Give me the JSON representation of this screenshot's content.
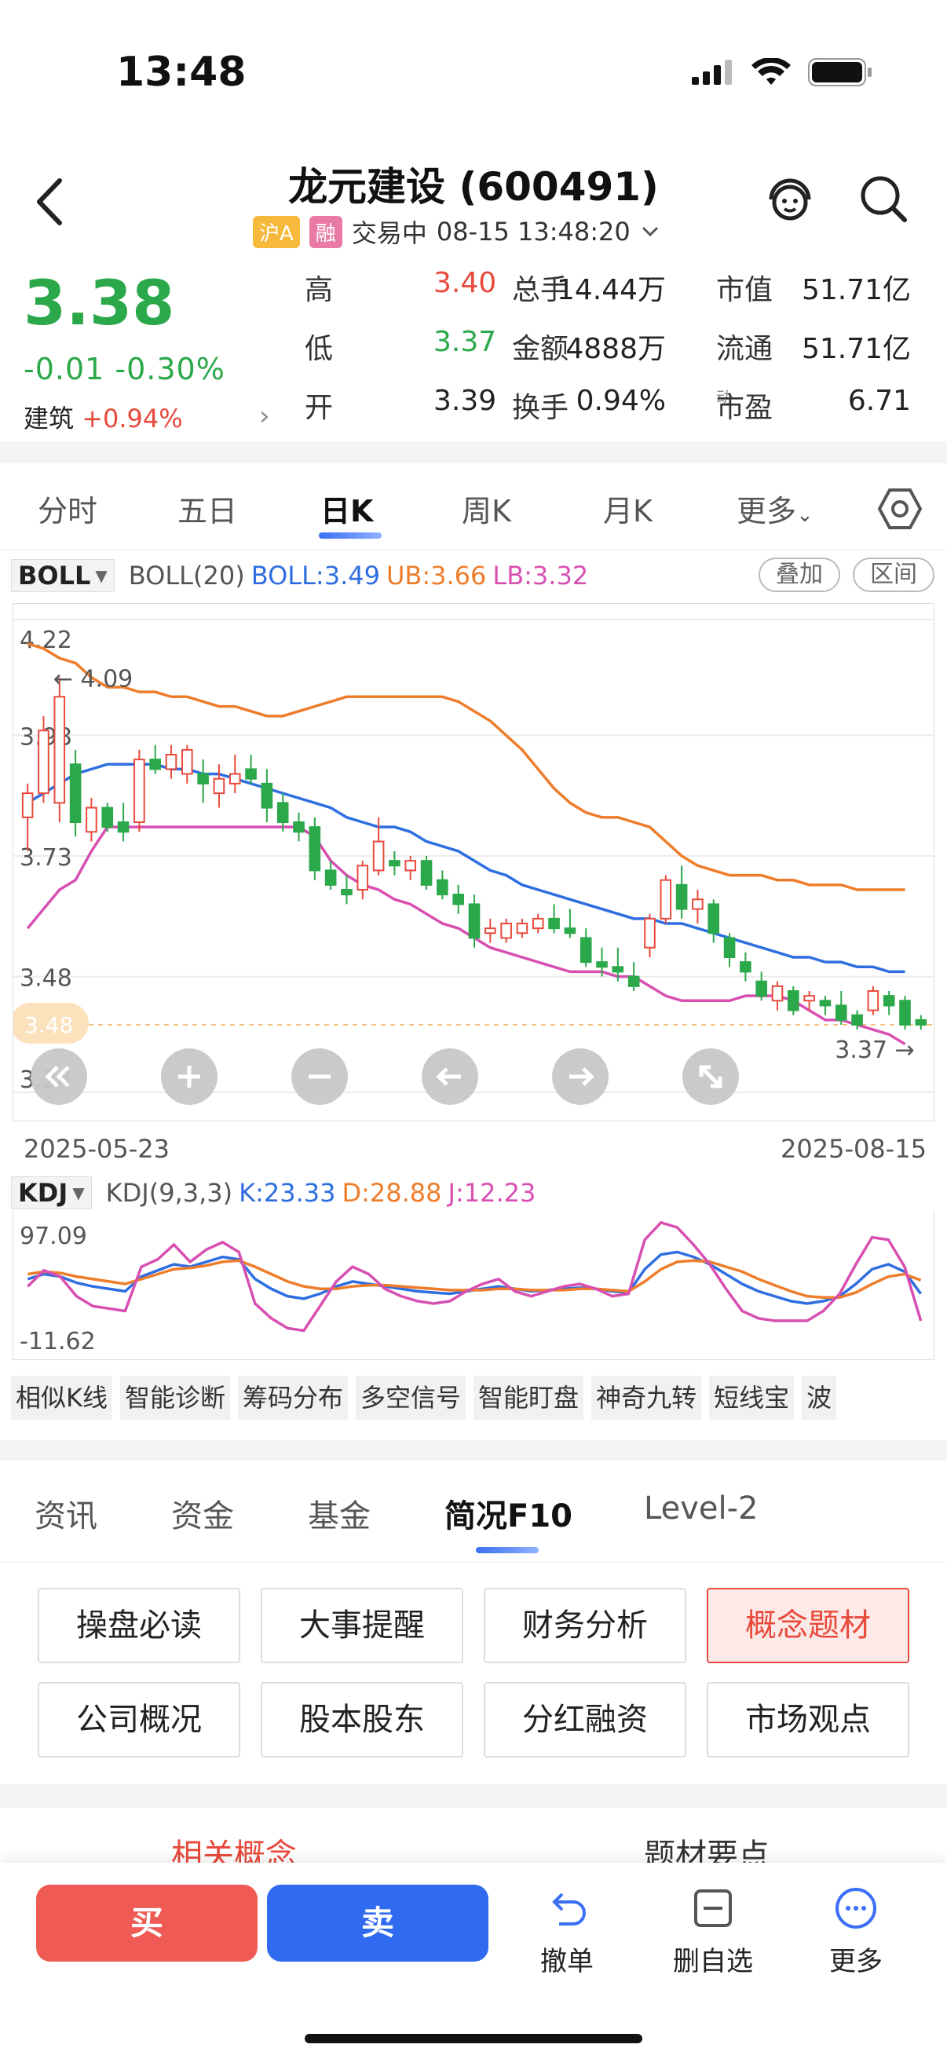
{
  "status": {
    "time": "13:48"
  },
  "header": {
    "title": "龙元建设 (600491)",
    "market_tag": "沪A",
    "margin_tag": "融",
    "trade_status": "交易中",
    "datetime": "08-15 13:48:20"
  },
  "quote": {
    "price": "3.38",
    "change": "-0.01 -0.30%",
    "sector_name": "建筑",
    "sector_change": "+0.94%",
    "rows": [
      {
        "l1": "高",
        "v1": "3.40",
        "l2": "总手",
        "v2": "14.44万",
        "l3": "市值",
        "v3": "51.71亿"
      },
      {
        "l1": "低",
        "v1": "3.37",
        "l2": "金额",
        "v2": "4888万",
        "l3": "流通",
        "v3": "51.71亿"
      },
      {
        "l1": "开",
        "v1": "3.39",
        "l2": "换手",
        "v2": "0.94%",
        "l3": "市盈",
        "l3_sup": "动",
        "v3": "6.71"
      }
    ]
  },
  "chart_tabs": [
    "分时",
    "五日",
    "日K",
    "周K",
    "月K",
    "更多"
  ],
  "boll_legend": {
    "indicator": "BOLL",
    "params": "BOLL(20)",
    "boll": "BOLL:3.49",
    "ub": "UB:3.66",
    "lb": "LB:3.32",
    "overlay_btn": "叠加",
    "range_btn": "区间"
  },
  "kdj_legend": {
    "indicator": "KDJ",
    "params": "KDJ(9,3,3)",
    "k": "K:23.33",
    "d": "D:28.88",
    "j": "J:12.23"
  },
  "colors": {
    "up": "#e84a3c",
    "down": "#2aa84a",
    "boll": "#2f6ee0",
    "ub": "#ee7d2b",
    "lb": "#d84fb2"
  },
  "chart_data": [
    {
      "type": "candlestick",
      "title": "",
      "y_tick_labels": [
        "4.22",
        "3.98",
        "3.73",
        "3.48",
        "3.24"
      ],
      "ylim": [
        3.24,
        4.22
      ],
      "x_tick_labels": [
        "2025-05-23",
        "2025-08-15"
      ],
      "annotations": {
        "high_label": "4.09",
        "low_label": "3.37",
        "current_price_badge": "3.48"
      },
      "candles": [
        {
          "o": 3.81,
          "h": 3.88,
          "l": 3.74,
          "c": 3.86
        },
        {
          "o": 3.86,
          "h": 4.02,
          "l": 3.84,
          "c": 3.99
        },
        {
          "o": 3.84,
          "h": 4.1,
          "l": 3.8,
          "c": 4.06
        },
        {
          "o": 3.92,
          "h": 3.95,
          "l": 3.77,
          "c": 3.8
        },
        {
          "o": 3.78,
          "h": 3.85,
          "l": 3.76,
          "c": 3.83
        },
        {
          "o": 3.83,
          "h": 3.84,
          "l": 3.78,
          "c": 3.79
        },
        {
          "o": 3.8,
          "h": 3.84,
          "l": 3.76,
          "c": 3.78
        },
        {
          "o": 3.8,
          "h": 3.95,
          "l": 3.78,
          "c": 3.93
        },
        {
          "o": 3.93,
          "h": 3.96,
          "l": 3.9,
          "c": 3.91
        },
        {
          "o": 3.91,
          "h": 3.96,
          "l": 3.89,
          "c": 3.94
        },
        {
          "o": 3.9,
          "h": 3.96,
          "l": 3.88,
          "c": 3.95
        },
        {
          "o": 3.9,
          "h": 3.93,
          "l": 3.84,
          "c": 3.88
        },
        {
          "o": 3.86,
          "h": 3.92,
          "l": 3.83,
          "c": 3.89
        },
        {
          "o": 3.88,
          "h": 3.94,
          "l": 3.86,
          "c": 3.9
        },
        {
          "o": 3.91,
          "h": 3.94,
          "l": 3.88,
          "c": 3.89
        },
        {
          "o": 3.88,
          "h": 3.91,
          "l": 3.8,
          "c": 3.83
        },
        {
          "o": 3.84,
          "h": 3.86,
          "l": 3.78,
          "c": 3.8
        },
        {
          "o": 3.8,
          "h": 3.82,
          "l": 3.76,
          "c": 3.78
        },
        {
          "o": 3.79,
          "h": 3.81,
          "l": 3.68,
          "c": 3.7
        },
        {
          "o": 3.7,
          "h": 3.72,
          "l": 3.66,
          "c": 3.67
        },
        {
          "o": 3.66,
          "h": 3.69,
          "l": 3.63,
          "c": 3.65
        },
        {
          "o": 3.66,
          "h": 3.72,
          "l": 3.64,
          "c": 3.71
        },
        {
          "o": 3.7,
          "h": 3.81,
          "l": 3.69,
          "c": 3.76
        },
        {
          "o": 3.72,
          "h": 3.74,
          "l": 3.69,
          "c": 3.71
        },
        {
          "o": 3.7,
          "h": 3.73,
          "l": 3.68,
          "c": 3.72
        },
        {
          "o": 3.72,
          "h": 3.73,
          "l": 3.66,
          "c": 3.67
        },
        {
          "o": 3.68,
          "h": 3.7,
          "l": 3.64,
          "c": 3.65
        },
        {
          "o": 3.65,
          "h": 3.67,
          "l": 3.61,
          "c": 3.63
        },
        {
          "o": 3.63,
          "h": 3.65,
          "l": 3.54,
          "c": 3.56
        },
        {
          "o": 3.57,
          "h": 3.6,
          "l": 3.55,
          "c": 3.58
        },
        {
          "o": 3.56,
          "h": 3.6,
          "l": 3.55,
          "c": 3.59
        },
        {
          "o": 3.57,
          "h": 3.6,
          "l": 3.56,
          "c": 3.59
        },
        {
          "o": 3.58,
          "h": 3.61,
          "l": 3.57,
          "c": 3.6
        },
        {
          "o": 3.6,
          "h": 3.63,
          "l": 3.57,
          "c": 3.58
        },
        {
          "o": 3.58,
          "h": 3.62,
          "l": 3.56,
          "c": 3.57
        },
        {
          "o": 3.56,
          "h": 3.58,
          "l": 3.5,
          "c": 3.51
        },
        {
          "o": 3.51,
          "h": 3.54,
          "l": 3.48,
          "c": 3.5
        },
        {
          "o": 3.5,
          "h": 3.54,
          "l": 3.47,
          "c": 3.49
        },
        {
          "o": 3.48,
          "h": 3.51,
          "l": 3.45,
          "c": 3.46
        },
        {
          "o": 3.54,
          "h": 3.61,
          "l": 3.52,
          "c": 3.6
        },
        {
          "o": 3.6,
          "h": 3.69,
          "l": 3.59,
          "c": 3.68
        },
        {
          "o": 3.67,
          "h": 3.71,
          "l": 3.6,
          "c": 3.62
        },
        {
          "o": 3.62,
          "h": 3.66,
          "l": 3.59,
          "c": 3.64
        },
        {
          "o": 3.63,
          "h": 3.64,
          "l": 3.55,
          "c": 3.57
        },
        {
          "o": 3.56,
          "h": 3.57,
          "l": 3.5,
          "c": 3.52
        },
        {
          "o": 3.51,
          "h": 3.53,
          "l": 3.47,
          "c": 3.49
        },
        {
          "o": 3.47,
          "h": 3.49,
          "l": 3.43,
          "c": 3.44
        },
        {
          "o": 3.43,
          "h": 3.47,
          "l": 3.41,
          "c": 3.46
        },
        {
          "o": 3.45,
          "h": 3.46,
          "l": 3.4,
          "c": 3.41
        },
        {
          "o": 3.43,
          "h": 3.45,
          "l": 3.41,
          "c": 3.44
        },
        {
          "o": 3.43,
          "h": 3.44,
          "l": 3.4,
          "c": 3.42
        },
        {
          "o": 3.42,
          "h": 3.45,
          "l": 3.38,
          "c": 3.39
        },
        {
          "o": 3.4,
          "h": 3.41,
          "l": 3.37,
          "c": 3.38
        },
        {
          "o": 3.41,
          "h": 3.46,
          "l": 3.4,
          "c": 3.45
        },
        {
          "o": 3.44,
          "h": 3.45,
          "l": 3.4,
          "c": 3.42
        },
        {
          "o": 3.43,
          "h": 3.44,
          "l": 3.37,
          "c": 3.38
        },
        {
          "o": 3.39,
          "h": 3.4,
          "l": 3.37,
          "c": 3.38
        }
      ],
      "series": [
        {
          "name": "UB",
          "values": [
            4.17,
            4.16,
            4.14,
            4.13,
            4.1,
            4.08,
            4.08,
            4.07,
            4.07,
            4.06,
            4.06,
            4.05,
            4.04,
            4.04,
            4.03,
            4.02,
            4.02,
            4.03,
            4.04,
            4.05,
            4.06,
            4.06,
            4.06,
            4.06,
            4.06,
            4.06,
            4.06,
            4.05,
            4.03,
            4.01,
            3.98,
            3.95,
            3.91,
            3.87,
            3.84,
            3.82,
            3.81,
            3.81,
            3.8,
            3.79,
            3.76,
            3.73,
            3.71,
            3.7,
            3.69,
            3.69,
            3.69,
            3.68,
            3.68,
            3.67,
            3.67,
            3.67,
            3.66,
            3.66,
            3.66,
            3.66
          ]
        },
        {
          "name": "BOLL",
          "values": [
            3.84,
            3.86,
            3.88,
            3.9,
            3.91,
            3.92,
            3.92,
            3.92,
            3.92,
            3.91,
            3.91,
            3.9,
            3.9,
            3.89,
            3.88,
            3.87,
            3.86,
            3.85,
            3.84,
            3.83,
            3.81,
            3.8,
            3.79,
            3.79,
            3.78,
            3.76,
            3.75,
            3.74,
            3.72,
            3.7,
            3.69,
            3.67,
            3.66,
            3.65,
            3.64,
            3.63,
            3.62,
            3.61,
            3.6,
            3.6,
            3.59,
            3.59,
            3.58,
            3.57,
            3.56,
            3.55,
            3.54,
            3.53,
            3.52,
            3.52,
            3.51,
            3.51,
            3.5,
            3.5,
            3.49,
            3.49
          ]
        },
        {
          "name": "LB",
          "values": [
            3.58,
            3.62,
            3.66,
            3.68,
            3.74,
            3.79,
            3.79,
            3.79,
            3.79,
            3.79,
            3.79,
            3.79,
            3.79,
            3.79,
            3.79,
            3.79,
            3.79,
            3.79,
            3.77,
            3.72,
            3.69,
            3.67,
            3.66,
            3.64,
            3.63,
            3.61,
            3.59,
            3.58,
            3.56,
            3.54,
            3.53,
            3.52,
            3.51,
            3.5,
            3.49,
            3.49,
            3.49,
            3.48,
            3.48,
            3.46,
            3.44,
            3.43,
            3.43,
            3.43,
            3.43,
            3.44,
            3.44,
            3.44,
            3.43,
            3.41,
            3.39,
            3.39,
            3.38,
            3.37,
            3.36,
            3.34
          ]
        }
      ]
    },
    {
      "type": "line",
      "title": "",
      "y_tick_labels": [
        "97.09",
        "-11.62"
      ],
      "ylim": [
        -11.62,
        97.09
      ],
      "series": [
        {
          "name": "K",
          "values": [
            48,
            52,
            50,
            45,
            42,
            40,
            38,
            50,
            55,
            60,
            58,
            62,
            66,
            64,
            48,
            40,
            34,
            32,
            36,
            42,
            46,
            44,
            42,
            40,
            38,
            37,
            36,
            38,
            40,
            42,
            40,
            38,
            39,
            40,
            41,
            40,
            38,
            37,
            56,
            68,
            70,
            66,
            60,
            52,
            44,
            38,
            34,
            30,
            28,
            30,
            34,
            44,
            56,
            60,
            54,
            36
          ]
        },
        {
          "name": "D",
          "values": [
            52,
            54,
            53,
            50,
            48,
            46,
            44,
            48,
            52,
            56,
            57,
            59,
            62,
            63,
            58,
            52,
            46,
            42,
            40,
            40,
            42,
            43,
            43,
            42,
            41,
            40,
            39,
            39,
            39,
            40,
            40,
            39,
            39,
            39,
            40,
            40,
            39,
            38,
            46,
            56,
            62,
            63,
            62,
            58,
            54,
            48,
            43,
            38,
            34,
            33,
            33,
            37,
            44,
            50,
            52,
            47
          ]
        },
        {
          "name": "J",
          "values": [
            42,
            55,
            50,
            34,
            26,
            24,
            22,
            58,
            64,
            76,
            62,
            72,
            78,
            70,
            28,
            16,
            8,
            6,
            26,
            46,
            58,
            52,
            40,
            34,
            30,
            28,
            30,
            38,
            44,
            48,
            38,
            34,
            38,
            42,
            44,
            40,
            34,
            36,
            80,
            94,
            90,
            76,
            60,
            40,
            22,
            16,
            14,
            14,
            14,
            22,
            36,
            60,
            82,
            80,
            58,
            14
          ]
        }
      ]
    }
  ],
  "chart_controls": [
    "double-left-icon",
    "zoom-in-icon",
    "zoom-out-icon",
    "arrow-left-icon",
    "arrow-right-icon",
    "fullscreen-icon"
  ],
  "tools": [
    "相似K线",
    "智能诊断",
    "筹码分布",
    "多空信号",
    "智能盯盘",
    "神奇九转",
    "短线宝",
    "波"
  ],
  "info_tabs": [
    "资讯",
    "资金",
    "基金",
    "简况F10",
    "Level-2"
  ],
  "f10_buttons": [
    [
      "操盘必读",
      "大事提醒",
      "财务分析",
      "概念题材"
    ],
    [
      "公司概况",
      "股本股东",
      "分红融资",
      "市场观点"
    ]
  ],
  "bottom_section": {
    "left": "相关概念",
    "right": "题材要点"
  },
  "actions": {
    "buy": "买",
    "sell": "卖",
    "cancel": "撤单",
    "remove": "删自选",
    "more": "更多"
  }
}
